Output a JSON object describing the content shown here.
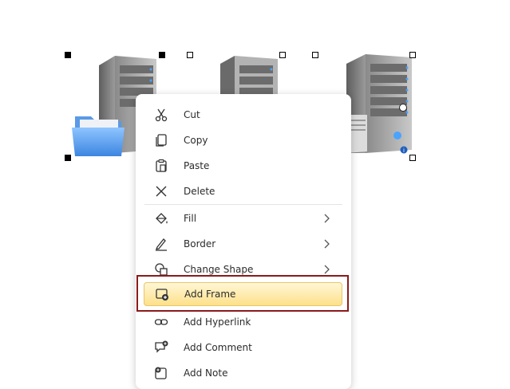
{
  "menu": {
    "items": [
      {
        "label": "Cut",
        "icon": "scissors-icon"
      },
      {
        "label": "Copy",
        "icon": "copy-icon"
      },
      {
        "label": "Paste",
        "icon": "clipboard-icon"
      },
      {
        "label": "Delete",
        "icon": "close-icon"
      },
      {
        "label": "Fill",
        "icon": "paint-bucket-icon",
        "submenu": true
      },
      {
        "label": "Border",
        "icon": "pen-icon",
        "submenu": true
      },
      {
        "label": "Change Shape",
        "icon": "shapes-icon",
        "submenu": true
      },
      {
        "label": "Add Frame",
        "icon": "add-frame-icon",
        "highlighted": true
      },
      {
        "label": "Add Hyperlink",
        "icon": "link-icon"
      },
      {
        "label": "Add Comment",
        "icon": "comment-icon"
      },
      {
        "label": "Add Note",
        "icon": "note-icon"
      }
    ]
  },
  "colors": {
    "highlight_annotation": "#8b1a1a",
    "menu_highlight": "#fde08a"
  }
}
